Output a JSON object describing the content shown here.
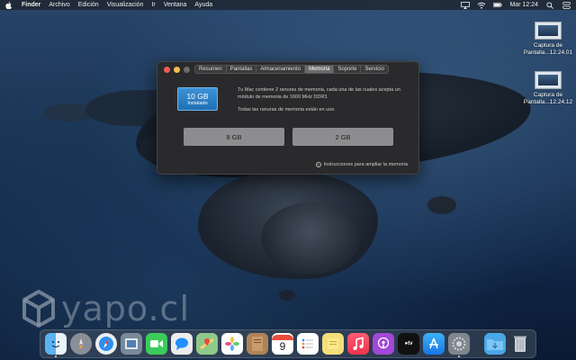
{
  "menubar": {
    "apple_icon": "apple-icon",
    "items": [
      "Finder",
      "Archivo",
      "Edición",
      "Visualización",
      "Ir",
      "Ventana",
      "Ayuda"
    ],
    "clock": "Mar 12:24"
  },
  "desktop": {
    "icons": [
      {
        "label_line1": "Captura de",
        "label_line2": "Pantalla...12.24.01"
      },
      {
        "label_line1": "Captura de",
        "label_line2": "Pantalla...12.24.12"
      }
    ]
  },
  "about_window": {
    "tabs": [
      "Resumen",
      "Pantallas",
      "Almacenamiento",
      "Memoria",
      "Soporte",
      "Servicio"
    ],
    "active_tab": "Memoria",
    "memory_total": "10 GB",
    "memory_status": "Instalado",
    "description": "Tu Mac contiene 2 ranuras de memoria, cada una de las cuales acepta un módulo de memoria de 1600 MHz DDR3.",
    "slots_note": "Todas las ranuras de memoria están en uso.",
    "slots": [
      "8 GB",
      "2 GB"
    ],
    "help_link": "Instrucciones para ampliar la memoria"
  },
  "watermark": {
    "text": "yapo.cl"
  },
  "dock": {
    "apps": [
      "finder-icon",
      "launchpad-icon",
      "safari-icon",
      "preview-icon",
      "messages-icon",
      "maps-icon",
      "photos-icon",
      "notes-icon",
      "calendar-icon",
      "reminders-icon",
      "stickies-icon",
      "music-icon",
      "podcasts-icon",
      "tv-icon",
      "app-store-icon",
      "system-preferences-icon",
      "downloads-folder-icon",
      "trash-icon"
    ],
    "calendar_day": "9"
  }
}
